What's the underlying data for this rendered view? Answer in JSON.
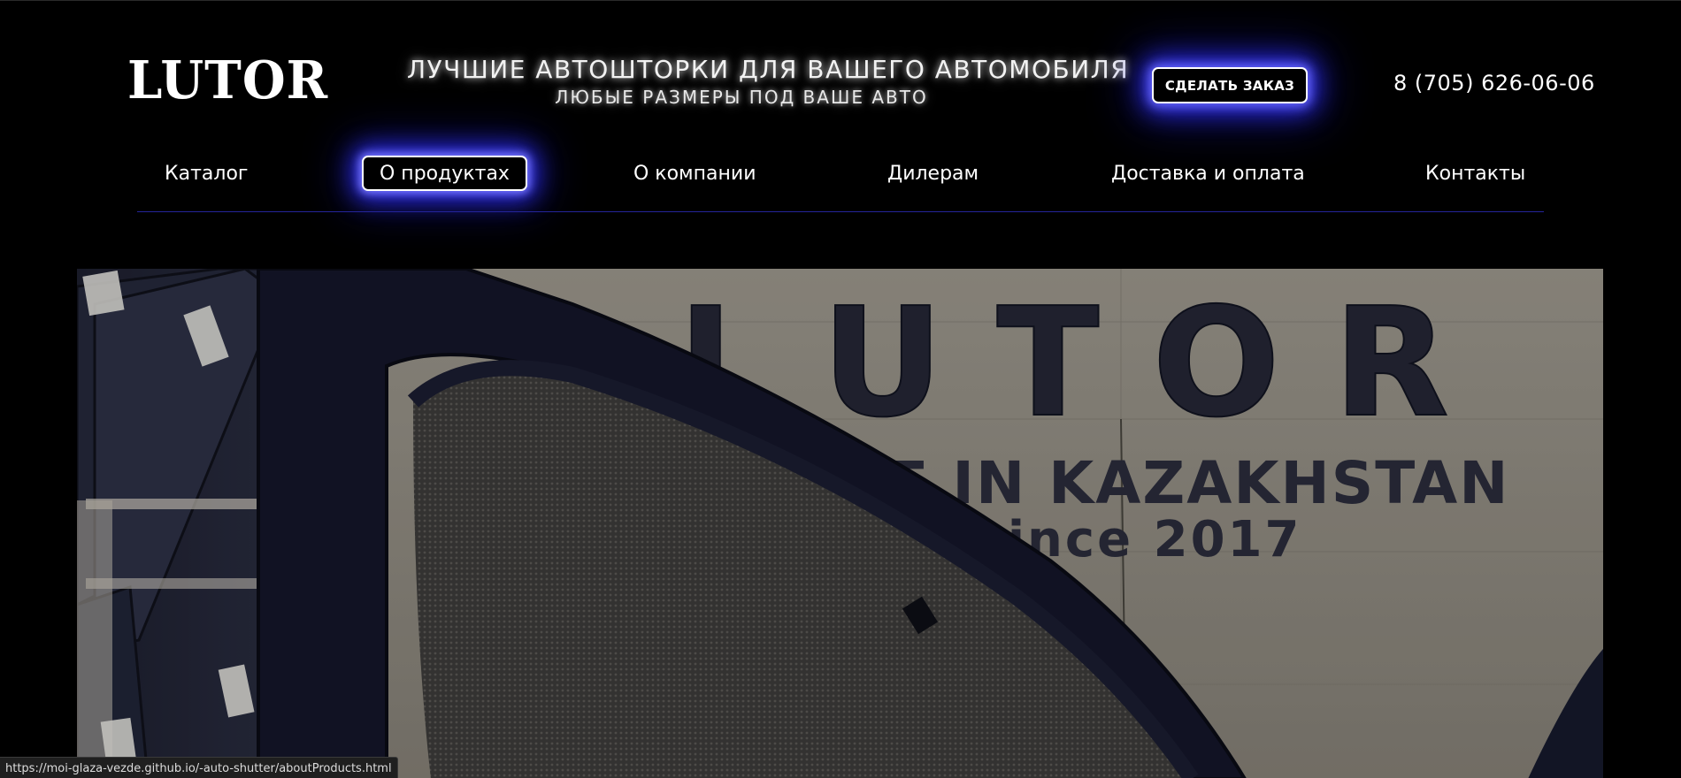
{
  "header": {
    "logo": "LUTOR",
    "tagline_main": "ЛУЧШИЕ АВТОШТОРКИ ДЛЯ ВАШЕГО АВТОМОБИЛЯ",
    "tagline_sub": "ЛЮБЫЕ РАЗМЕРЫ ПОД ВАШЕ АВТО",
    "order_button": "СДЕЛАТЬ ЗАКАЗ",
    "phone": "8 (705) 626-06-06"
  },
  "nav": {
    "items": [
      {
        "label": "Каталог",
        "active": false
      },
      {
        "label": "О продуктах",
        "active": true
      },
      {
        "label": "О компании",
        "active": false
      },
      {
        "label": "Дилерам",
        "active": false
      },
      {
        "label": "Доставка и оплата",
        "active": false
      },
      {
        "label": "Контакты",
        "active": false
      }
    ]
  },
  "hero": {
    "sign_brand": "LUTOR",
    "sign_origin": "DE IN KAZAKHSTAN",
    "sign_since": "since 2017"
  },
  "statusbar": {
    "url": "https://moi-glaza-vezde.github.io/-auto-shutter/aboutProducts.html"
  },
  "colors": {
    "background": "#000000",
    "glow": "#3232ff",
    "nav_divider": "#24249a"
  }
}
